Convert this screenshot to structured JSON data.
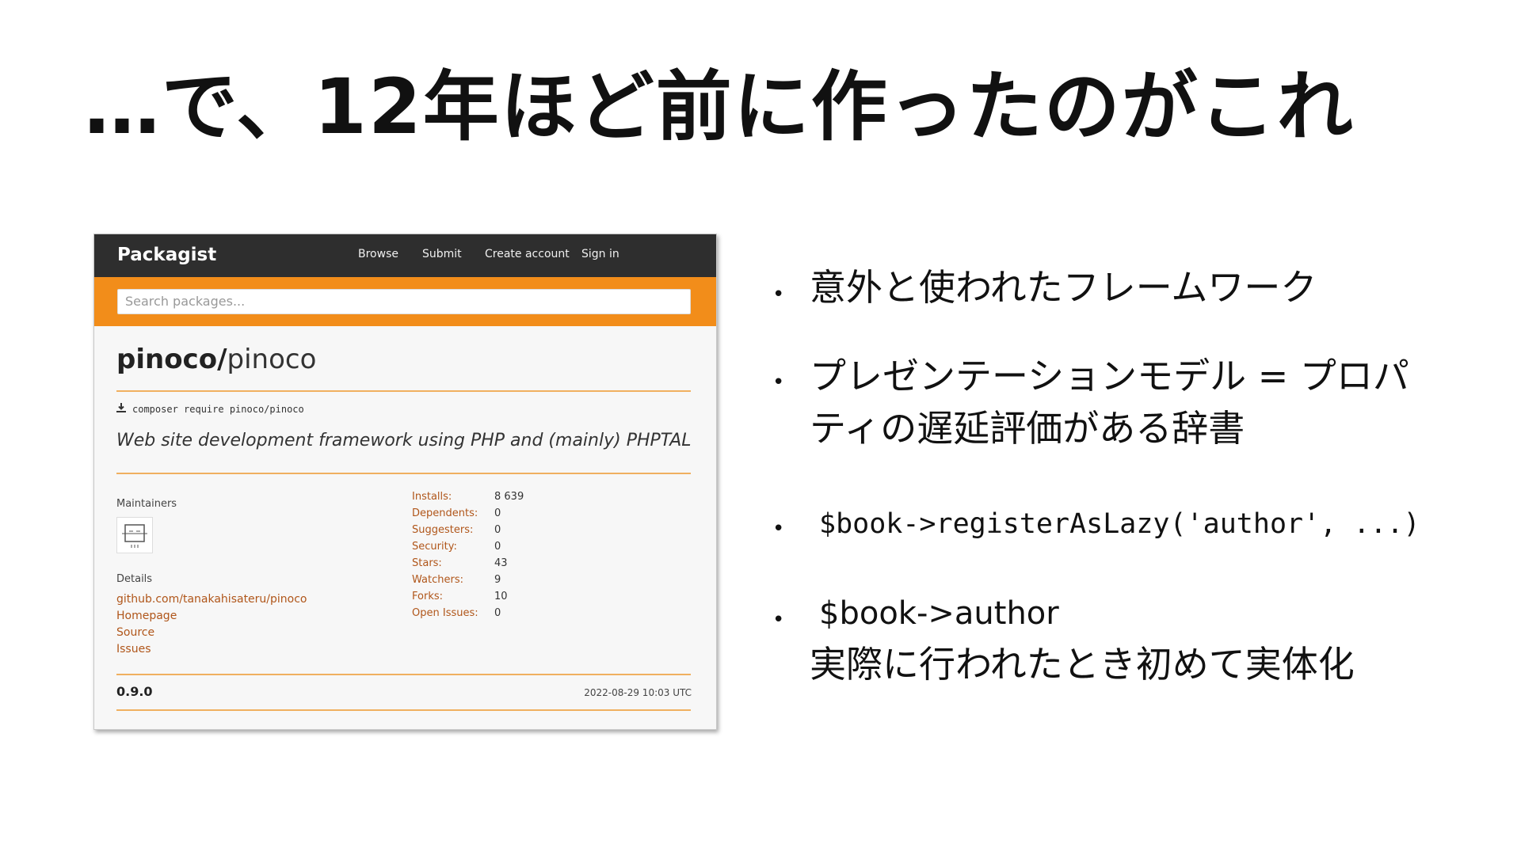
{
  "slide": {
    "title": "…で、12年ほど前に作ったのがこれ"
  },
  "packagist": {
    "logo": "Packagist",
    "nav": [
      "Browse",
      "Submit",
      "Create account",
      "Sign in"
    ],
    "search_placeholder": "Search packages...",
    "package_vendor": "pinoco/",
    "package_name": "pinoco",
    "install_command": "composer require pinoco/pinoco",
    "description": "Web site development framework using PHP and (mainly) PHPTAL",
    "maintainers_label": "Maintainers",
    "details_label": "Details",
    "details_links": [
      "github.com/tanakahisateru/pinoco",
      "Homepage",
      "Source",
      "Issues"
    ],
    "stats": [
      {
        "label": "Installs:",
        "value": "8 639"
      },
      {
        "label": "Dependents:",
        "value": "0"
      },
      {
        "label": "Suggesters:",
        "value": "0"
      },
      {
        "label": "Security:",
        "value": "0"
      },
      {
        "label": "Stars:",
        "value": "43"
      },
      {
        "label": "Watchers:",
        "value": "9"
      },
      {
        "label": "Forks:",
        "value": "10"
      },
      {
        "label": "Open Issues:",
        "value": "0"
      }
    ],
    "version": "0.9.0",
    "release_date": "2022-08-29 10:03 UTC",
    "colors": {
      "nav_bg": "#2e2e2e",
      "accent": "#f28d1a",
      "link": "#b0561a"
    }
  },
  "bullets": {
    "b1": "意外と使われたフレームワーク",
    "b2_line1": "プレゼンテーションモデル = プロパ",
    "b2_line2": "ティの遅延評価がある辞書",
    "b3": "$book->registerAsLazy('author', ...)",
    "b4_line1": "$book->author",
    "b4_line2": "実際に行われたとき初めて実体化",
    "marker": "•"
  }
}
